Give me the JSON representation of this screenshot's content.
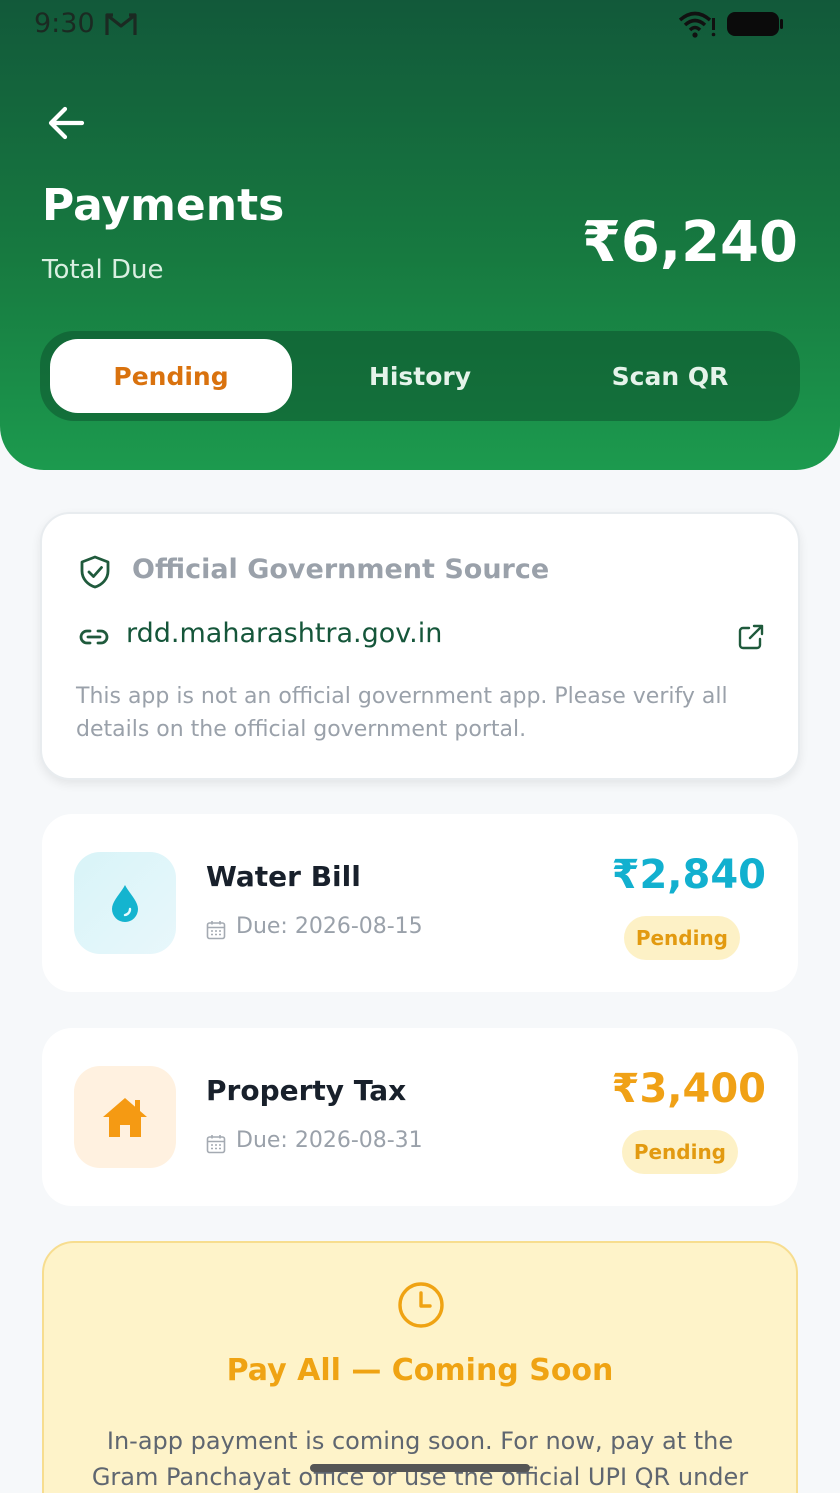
{
  "status_bar": {
    "time": "9:30",
    "icons": [
      "gmail-icon",
      "wifi-icon",
      "battery-icon"
    ]
  },
  "header": {
    "back_icon": "arrow-left-icon",
    "title": "Payments",
    "total_label": "Total Due",
    "total_amount": "₹6,240"
  },
  "tabs": [
    {
      "label": "Pending",
      "active": true
    },
    {
      "label": "History",
      "active": false
    },
    {
      "label": "Scan QR",
      "active": false
    }
  ],
  "source_card": {
    "icon": "shield-check-icon",
    "title": "Official Government Source",
    "link_icon": "link-icon",
    "link": "rdd.maharashtra.gov.in",
    "external_icon": "external-link-icon",
    "disclaimer": "This app is not an official government app. Please verify all details on the official government portal."
  },
  "bills": [
    {
      "name": "Water Bill",
      "icon": "water-drop-icon",
      "due": "Due: 2026-08-15",
      "amount": "₹2,840",
      "status": "Pending",
      "accent": "#12b0cf"
    },
    {
      "name": "Property Tax",
      "icon": "house-icon",
      "due": "Due: 2026-08-31",
      "amount": "₹3,400",
      "status": "Pending",
      "accent": "#f0a116"
    }
  ],
  "pay_all": {
    "icon": "clock-icon",
    "title": "Pay All — Coming Soon",
    "description": "In-app payment is coming soon. For now, pay at the Gram Panchayat office or use the official UPI QR under"
  },
  "colors": {
    "header_dark": "#12593a",
    "header_light": "#1c9a4e",
    "active_tab_text": "#d9720e",
    "pending_badge_bg": "#fdf1c6",
    "pending_badge_text": "#e29a10"
  }
}
